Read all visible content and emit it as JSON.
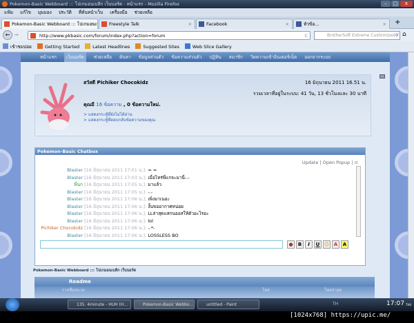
{
  "window": {
    "title": "Pokemon-Basic Webboard ::: โปเกมอนเบสิก เว็บบอร์ด - หน้าแรก - Mozilla Firefox"
  },
  "menu": [
    "แฟ้ม",
    "แก้ไข",
    "มุมมอง",
    "ประวัติ",
    "ที่คั่นหน้าเว็บ",
    "เครื่องมือ",
    "ช่วยเหลือ"
  ],
  "tabs": [
    {
      "label": "Pokemon-Basic Webboard ::: โปเกมอนเบ..."
    },
    {
      "label": "Freestyle Talk"
    },
    {
      "label": "Facebook"
    },
    {
      "label": "หัวข้อ..."
    }
  ],
  "address": {
    "url": "http://www.pkbasic.com/forum/index.php?action=forum",
    "search_placeholder": "BrotherSoft Extreme Customized Y"
  },
  "bookmarks": [
    {
      "label": "เข้าชมบ่อย",
      "color": "#6a8fd0"
    },
    {
      "label": "Getting Started",
      "color": "#e07020"
    },
    {
      "label": "Latest Headlines",
      "color": "#e8b030"
    },
    {
      "label": "Suggested Sites",
      "color": "#e08a20"
    },
    {
      "label": "Web Slice Gallery",
      "color": "#3a7ad0"
    }
  ],
  "site_nav": [
    "หน้าแรก",
    "เว็บบอร์ด",
    "ช่วยเหลือ",
    "ค้นหา",
    "ข้อมูลส่วนตัว",
    "ข้อความส่วนตัว",
    "ปฏิทิน",
    "สมาชิก",
    "วิดความเข้าอินเตอร์เน็ต",
    "ออกจากระบบ"
  ],
  "welcome": {
    "greeting": "สวัสดี Pichiker Chocokidz",
    "date": "16 มิถุนายน 2011 16.51 น.",
    "online_time": "รวมเวลาที่อยู่ในระบบ: 41 วัน, 13 ชั่วโมงและ 30 นาที",
    "msg_prefix": "คุณมี",
    "msg_count": "16 ข้อความ",
    "msg_suffix": ", 0 ข้อความใหม่.",
    "link1": "> แสดงกระทู้ที่ยังไม่ได้อ่าน",
    "link2": "> แสดงกระทู้ที่ตอบกลับข้อความของคุณ"
  },
  "chatbox": {
    "title": "Pokemon-Basic Chatbox",
    "update": "Update",
    "open_popup": "Open Popup",
    "sep": "|",
    "messages": [
      {
        "user": "Blaster",
        "time": "[16 มิถุนายน 2011 17:01 น.]:",
        "text": "= =",
        "color": "#3a8a9a"
      },
      {
        "user": "Blaster",
        "time": "[16 มิถุนายน 2011 17:03 น.]:",
        "text": "เมื่อไหร่พี่แกจะมานี่-.-",
        "color": "#3a8a9a"
      },
      {
        "user": "พี่นก",
        "time": "[16 มิถุนายน 2011 17:05 น.]:",
        "text": "มาแล้ว",
        "color": "#3a9a3a"
      },
      {
        "user": "Blaster",
        "time": "[16 มิถุนายน 2011 17:05 น.]:",
        "text": "-.-",
        "color": "#3a8a9a"
      },
      {
        "user": "Blaster",
        "time": "[16 มิถุนายน 2011 17:06 น.]:",
        "text": "เพิ่งมาเนอะ",
        "color": "#3a8a9a"
      },
      {
        "user": "Blaster",
        "time": "[16 มิถุนายน 2011 17:06 น.]:",
        "text": "งั้นขออากาศหน่อย",
        "color": "#3a8a9a"
      },
      {
        "user": "Blaster",
        "time": "[16 มิถุนายน 2011 17:06 น.]:",
        "text": "LLล่าสุดแสกนออสให้ตัวอะไรอะ",
        "color": "#3a8a9a"
      },
      {
        "user": "Blaster",
        "time": "[16 มิถุนายน 2011 17:06 น.]:",
        "text": "lol",
        "color": "#3a8a9a"
      },
      {
        "user": "Pichiker Chocokidz",
        "time": "[16 มิถุนายน 2011 17:06 น.]:",
        "text": "-.*-",
        "color": "#c8602a"
      },
      {
        "user": "Blaster",
        "time": "[16 มิถุนายน 2011 17:06 น.]:",
        "text": "LOSSLESS BO",
        "color": "#3a8a9a"
      }
    ],
    "toolbar": [
      "B",
      "I",
      "U",
      "☺",
      "A",
      "A"
    ]
  },
  "footer": {
    "breadcrumb": "Pokemon-Basic Webboard ::: โปเกมอนเบสิก เว็บบอร์ด",
    "section": "Readme",
    "col1": "รายชื่อหมวด",
    "col2": "โพส",
    "col3": "โพสล่าสุด"
  },
  "taskbar": {
    "items": [
      "135. 4minute - HUH (H...",
      "Pokemon-Basic Webbo...",
      "untitled - Paint"
    ],
    "lang": "TH",
    "clock": "17:07",
    "day": "THU"
  },
  "watermark": "[1024x768] https://upic.me/"
}
